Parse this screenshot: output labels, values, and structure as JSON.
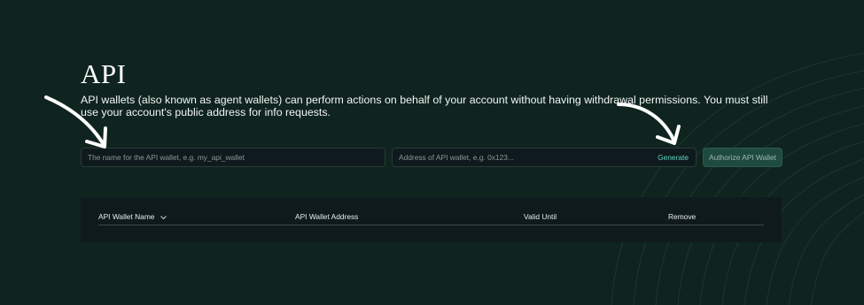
{
  "page": {
    "title": "API",
    "description": "API wallets (also known as agent wallets) can perform actions on behalf of your account without having withdrawal permissions. You must still use your account's public address for info requests."
  },
  "form": {
    "name_placeholder": "The name for the API wallet, e.g. my_api_wallet",
    "address_placeholder": "Address of API wallet, e.g. 0x123...",
    "generate_label": "Generate",
    "authorize_label": "Authorize API Wallet"
  },
  "table": {
    "columns": [
      "API Wallet Name",
      "API Wallet Address",
      "Valid Until",
      "Remove"
    ]
  },
  "colors": {
    "background": "#0f241f",
    "accent": "#5fd4c0",
    "button": "#1f4a3f"
  },
  "icons": {
    "sort": "chevron-down-icon",
    "annotation": "arrow-annotation-icon"
  }
}
